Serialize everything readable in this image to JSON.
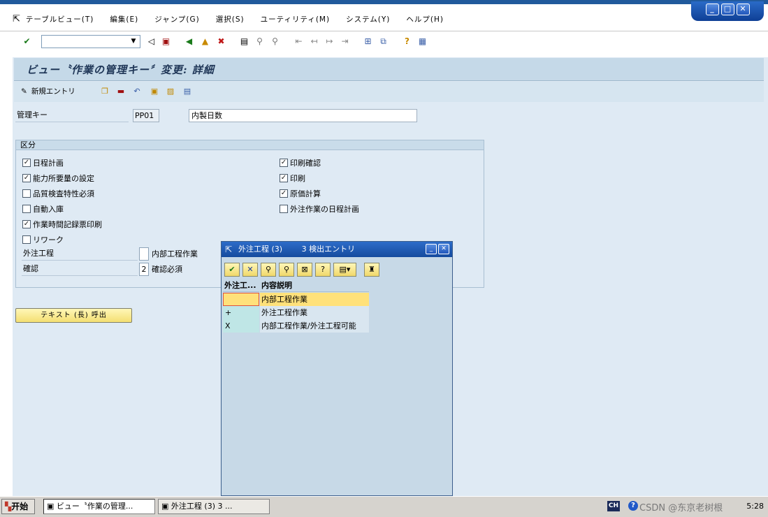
{
  "window": {
    "controls": [
      "_",
      "□",
      "✕"
    ]
  },
  "menu": {
    "items": [
      "テーブルビュー(T)",
      "編集(E)",
      "ジャンプ(G)",
      "選択(S)",
      "ユーティリティ(M)",
      "システム(Y)",
      "ヘルプ(H)"
    ]
  },
  "toolbar": {
    "command_value": "",
    "icons": [
      "enter-icon",
      "dropdown-icon",
      "back-arrow-icon",
      "save-icon",
      "back-icon",
      "exit-icon",
      "cancel-icon",
      "print-icon",
      "find-icon",
      "find-next-icon",
      "first-page-icon",
      "previous-page-icon",
      "next-page-icon",
      "last-page-icon",
      "new-session-icon",
      "shortcut-icon",
      "help-icon",
      "layout-icon"
    ]
  },
  "page": {
    "title": "ビュー〝作業の管理キー〞変更: 詳細",
    "new_entries_label": "新規エントリ"
  },
  "key": {
    "label": "管理キー",
    "value": "PP01",
    "description": "内製日数"
  },
  "group": {
    "title": "区分",
    "left_checkboxes": [
      {
        "label": "日程計画",
        "checked": true
      },
      {
        "label": "能力所要量の設定",
        "checked": true
      },
      {
        "label": "品質検査特性必須",
        "checked": false
      },
      {
        "label": "自動入庫",
        "checked": false
      },
      {
        "label": "作業時間記録票印刷",
        "checked": true
      },
      {
        "label": "リワーク",
        "checked": false
      }
    ],
    "right_checkboxes": [
      {
        "label": "印刷確認",
        "checked": true
      },
      {
        "label": "印刷",
        "checked": true
      },
      {
        "label": "原価計算",
        "checked": true
      },
      {
        "label": "外注作業の日程計画",
        "checked": false
      }
    ],
    "external_processing": {
      "label": "外注工程",
      "value": "",
      "text": "内部工程作業"
    },
    "confirmation": {
      "label": "確認",
      "value": "2",
      "text": "確認必須"
    }
  },
  "longtext_button": "テキスト (長) 呼出",
  "popup": {
    "title": "外注工程 (3)",
    "subtitle": "3 検出エントリ",
    "columns": [
      "外注工...",
      "内容説明"
    ],
    "rows": [
      {
        "code": "",
        "desc": "内部工程作業",
        "selected": true
      },
      {
        "code": "+",
        "desc": "外注工程作業",
        "selected": false
      },
      {
        "code": "X",
        "desc": "内部工程作業/外注工程可能",
        "selected": false
      }
    ]
  },
  "taskbar": {
    "start": "开始",
    "tasks": [
      "ビュー〝作業の管理...",
      "外注工程 (3)     3 ..."
    ],
    "ime": "CH",
    "watermark": "CSDN @东京老树根",
    "clock": "5:28"
  }
}
